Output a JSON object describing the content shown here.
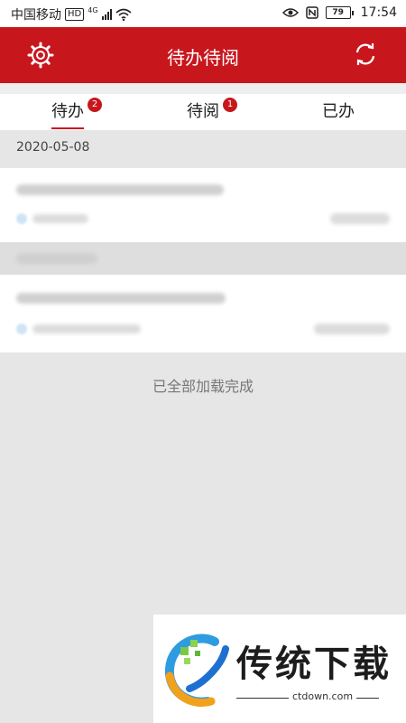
{
  "status_bar": {
    "carrier": "中国移动",
    "hd_badge": "HD",
    "network": "4G",
    "battery": "79",
    "time": "17:54",
    "icons": [
      "signal-icon",
      "wifi-icon",
      "eye-icon",
      "nfc-icon",
      "battery-icon"
    ]
  },
  "header": {
    "title": "待办待阅",
    "left_icon": "gear-icon",
    "right_icon": "refresh-icon",
    "background": "#c8161d"
  },
  "tabs": [
    {
      "label": "待办",
      "badge": "2",
      "active": true
    },
    {
      "label": "待阅",
      "badge": "1",
      "active": false
    },
    {
      "label": "已办",
      "badge": "",
      "active": false
    }
  ],
  "list": {
    "date": "2020-05-08",
    "load_complete": "已全部加载完成"
  },
  "watermark": {
    "brand": "传统下载",
    "url": "ctdown.com"
  }
}
